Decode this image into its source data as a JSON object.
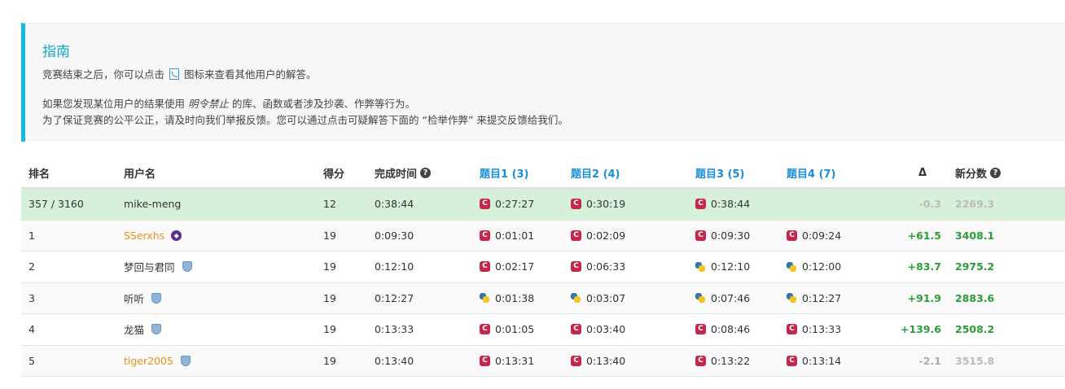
{
  "guide": {
    "title": "指南",
    "line1_pre": "竞赛结束之后，你可以点击",
    "line1_post": "图标来查看其他用户的解答。",
    "line2_pre": "如果您发现某位用户的结果使用",
    "line2_em": "明令禁止",
    "line2_post": "的库、函数或者涉及抄袭、作弊等行为。",
    "line3": "为了保证竞赛的公平公正，请及时向我们举报反馈。您可以通过点击可疑解答下面的 “检举作弊” 来提交反馈给我们。"
  },
  "table": {
    "headers": {
      "rank": "排名",
      "user": "用户名",
      "score": "得分",
      "time": "完成时间",
      "q1": "题目1 (3)",
      "q2": "题目2 (4)",
      "q3": "题目3 (5)",
      "q4": "题目4 (7)",
      "delta": "Δ",
      "new": "新分数"
    },
    "rows": [
      {
        "rank": "357 / 3160",
        "user": "mike-meng",
        "score": "12",
        "time": "0:38:44",
        "q1": "0:27:27",
        "q2": "0:30:19",
        "q3": "0:38:44",
        "q4": "",
        "delta": "-0.3",
        "new": "2269.3"
      },
      {
        "rank": "1",
        "user": "SSerxhs",
        "score": "19",
        "time": "0:09:30",
        "q1": "0:01:01",
        "q2": "0:02:09",
        "q3": "0:09:30",
        "q4": "0:09:24",
        "delta": "+61.5",
        "new": "3408.1"
      },
      {
        "rank": "2",
        "user": "梦回与君同",
        "score": "19",
        "time": "0:12:10",
        "q1": "0:02:17",
        "q2": "0:06:33",
        "q3": "0:12:10",
        "q4": "0:12:00",
        "delta": "+83.7",
        "new": "2975.2"
      },
      {
        "rank": "3",
        "user": "听听",
        "score": "19",
        "time": "0:12:27",
        "q1": "0:01:38",
        "q2": "0:03:07",
        "q3": "0:07:46",
        "q4": "0:12:27",
        "delta": "+91.9",
        "new": "2883.6"
      },
      {
        "rank": "4",
        "user": "龙猫",
        "score": "19",
        "time": "0:13:33",
        "q1": "0:01:05",
        "q2": "0:03:40",
        "q3": "0:08:46",
        "q4": "0:13:33",
        "delta": "+139.6",
        "new": "2508.2"
      },
      {
        "rank": "5",
        "user": "tiger2005",
        "score": "19",
        "time": "0:13:40",
        "q1": "0:13:31",
        "q2": "0:13:40",
        "q3": "0:13:22",
        "q4": "0:13:14",
        "delta": "-2.1",
        "new": "3515.8"
      }
    ]
  }
}
